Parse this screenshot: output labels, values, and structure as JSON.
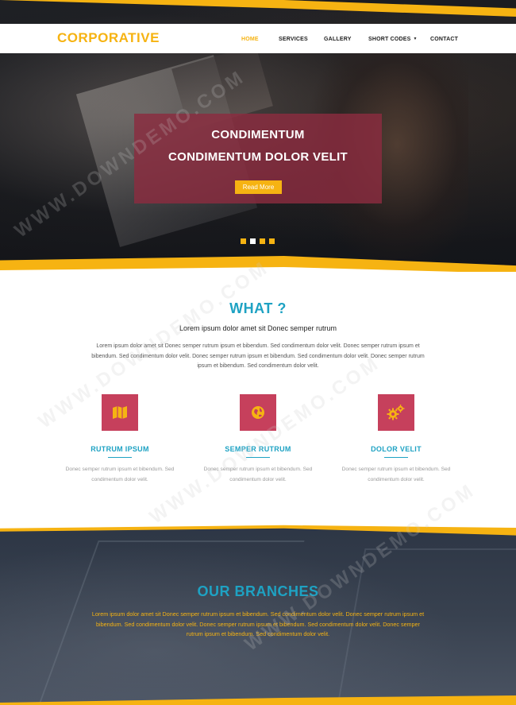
{
  "header": {
    "logo": "CORPORATIVE",
    "nav": [
      {
        "label": "HOME",
        "active": true
      },
      {
        "label": "SERVICES",
        "active": false
      },
      {
        "label": "GALLERY",
        "active": false
      },
      {
        "label": "SHORT CODES",
        "active": false,
        "has_dropdown": true
      },
      {
        "label": "CONTACT",
        "active": false
      }
    ]
  },
  "hero": {
    "title_line1": "CONDIMENTUM",
    "title_line2": "CONDIMENTUM DOLOR VELIT",
    "button_label": "Read More",
    "slides": 4,
    "active_slide_colors": [
      "#f6b312",
      "#ffffff",
      "#f6b312",
      "#f6b312"
    ]
  },
  "what": {
    "title": "WHAT ?",
    "subtitle": "Lorem ipsum dolor amet sit Donec semper rutrum",
    "paragraph": "Lorem ipsum dolor amet sit Donec semper rutrum ipsum et bibendum. Sed condimentum dolor velit. Donec semper rutrum ipsum et bibendum. Sed condimentum dolor velit. Donec semper rutrum ipsum et bibendum. Sed condimentum dolor velit. Donec semper rutrum ipsum et bibendum. Sed condimentum dolor velit.",
    "features": [
      {
        "icon": "map-icon",
        "title": "RUTRUM IPSUM",
        "text": "Donec semper rutrum ipsum et bibendum. Sed condimentum dolor velit."
      },
      {
        "icon": "globe-icon",
        "title": "SEMPER RUTRUM",
        "text": "Donec semper rutrum ipsum et bibendum. Sed condimentum dolor velit."
      },
      {
        "icon": "gears-icon",
        "title": "DOLOR VELIT",
        "text": "Donec semper rutrum ipsum et bibendum. Sed condimentum dolor velit."
      }
    ]
  },
  "branches": {
    "title": "OUR BRANCHES",
    "paragraph": "Lorem ipsum dolor amet sit Donec semper rutrum ipsum et bibendum. Sed condimentum dolor velit. Donec semper rutrum ipsum et bibendum. Sed condimentum dolor velit. Donec semper rutrum ipsum et bibendum. Sed condimentum dolor velit. Donec semper rutrum ipsum et bibendum. Sed condimentum dolor velit."
  },
  "watermark": "WWW.DOWNDEMO.COM",
  "colors": {
    "accent_yellow": "#f6b312",
    "accent_blue": "#1ea2c3",
    "accent_crimson": "#c6405c",
    "hero_card": "#8b2c40"
  }
}
